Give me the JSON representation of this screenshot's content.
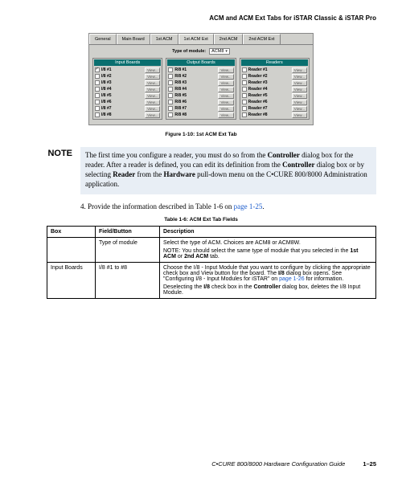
{
  "header": {
    "title": "ACM and ACM Ext Tabs for iSTAR Classic & iSTAR Pro"
  },
  "screenshot": {
    "tabs": [
      "General",
      "Main Board",
      "1st ACM",
      "1st ACM Ext",
      "2nd ACM",
      "2nd ACM Ext"
    ],
    "active_tab_index": 3,
    "module_label": "Type of module:",
    "module_value": "ACM8",
    "columns": [
      {
        "title": "Input Boards",
        "items": [
          {
            "label": "I/8 #1",
            "checked": true
          },
          {
            "label": "I/8 #2",
            "checked": false
          },
          {
            "label": "I/8 #3",
            "checked": false
          },
          {
            "label": "I/8 #4",
            "checked": false
          },
          {
            "label": "I/8 #5",
            "checked": false
          },
          {
            "label": "I/8 #6",
            "checked": false
          },
          {
            "label": "I/8 #7",
            "checked": false
          },
          {
            "label": "I/8 #8",
            "checked": false
          }
        ]
      },
      {
        "title": "Output Boards",
        "items": [
          {
            "label": "R/8 #1",
            "checked": false
          },
          {
            "label": "R/8 #2",
            "checked": false
          },
          {
            "label": "R/8 #3",
            "checked": false
          },
          {
            "label": "R/8 #4",
            "checked": false
          },
          {
            "label": "R/8 #5",
            "checked": false
          },
          {
            "label": "R/8 #6",
            "checked": false
          },
          {
            "label": "R/8 #7",
            "checked": false
          },
          {
            "label": "R/8 #8",
            "checked": false
          }
        ]
      },
      {
        "title": "Readers",
        "items": [
          {
            "label": "Reader #1",
            "checked": false
          },
          {
            "label": "Reader #2",
            "checked": false
          },
          {
            "label": "Reader #3",
            "checked": false
          },
          {
            "label": "Reader #4",
            "checked": false
          },
          {
            "label": "Reader #5",
            "checked": false
          },
          {
            "label": "Reader #6",
            "checked": false
          },
          {
            "label": "Reader #7",
            "checked": false
          },
          {
            "label": "Reader #8",
            "checked": false
          }
        ]
      }
    ],
    "view_label": "View..."
  },
  "figure_caption": "Figure 1-10:  1st ACM Ext Tab",
  "note": {
    "label": "NOTE",
    "body_parts": [
      {
        "t": "The first time you configure a reader, you must do so from the "
      },
      {
        "t": "Controller",
        "b": true
      },
      {
        "t": " dialog box for the reader. After a reader is defined, you can edit its definition from the "
      },
      {
        "t": "Controller",
        "b": true
      },
      {
        "t": " dialog box or by selecting "
      },
      {
        "t": "Reader",
        "b": true
      },
      {
        "t": " from the "
      },
      {
        "t": "Hardware",
        "b": true
      },
      {
        "t": " pull-down menu on the C•CURE 800/8000 Administration application."
      }
    ]
  },
  "step": {
    "num": "4.",
    "text_before": "Provide the information described in Table 1-6 on ",
    "link": "page 1-25",
    "text_after": "."
  },
  "table_caption": "Table 1-6:  ACM Ext Tab Fields",
  "table": {
    "headers": [
      "Box",
      "Field/Button",
      "Description"
    ],
    "rows": [
      {
        "box": "",
        "field": "Type of module",
        "desc": {
          "main": "Select the type of ACM. Choices are ACM8 or ACM8W.",
          "note_prefix": "NOTE: You should select the same type of module that you selected in the ",
          "note_b1": "1st ACM",
          "note_mid": " or ",
          "note_b2": "2nd ACM",
          "note_suffix": " tab."
        }
      },
      {
        "box": "Input Boards",
        "field": "I/8 #1 to #8",
        "desc": {
          "p1_a": "Choose the I/8 - Input Module that you want to configure by clicking the appropriate check box and ",
          "p1_view": "View",
          "p1_b": " button for the board. The ",
          "p1_i8": "I/8",
          "p1_c": " dialog box opens. See \"Configuring I/8 - Input Modules for iSTAR\" on ",
          "p1_link": "page 1-26",
          "p1_d": " for information.",
          "p2_a": "Deselecting the ",
          "p2_i8": "I/8",
          "p2_b": " check box in the ",
          "p2_ctrl": "Controller",
          "p2_c": " dialog box, deletes the I/8 Input Module."
        }
      }
    ]
  },
  "footer": {
    "guide": "C•CURE 800/8000 Hardware Configuration Guide",
    "pagenum": "1–25"
  }
}
